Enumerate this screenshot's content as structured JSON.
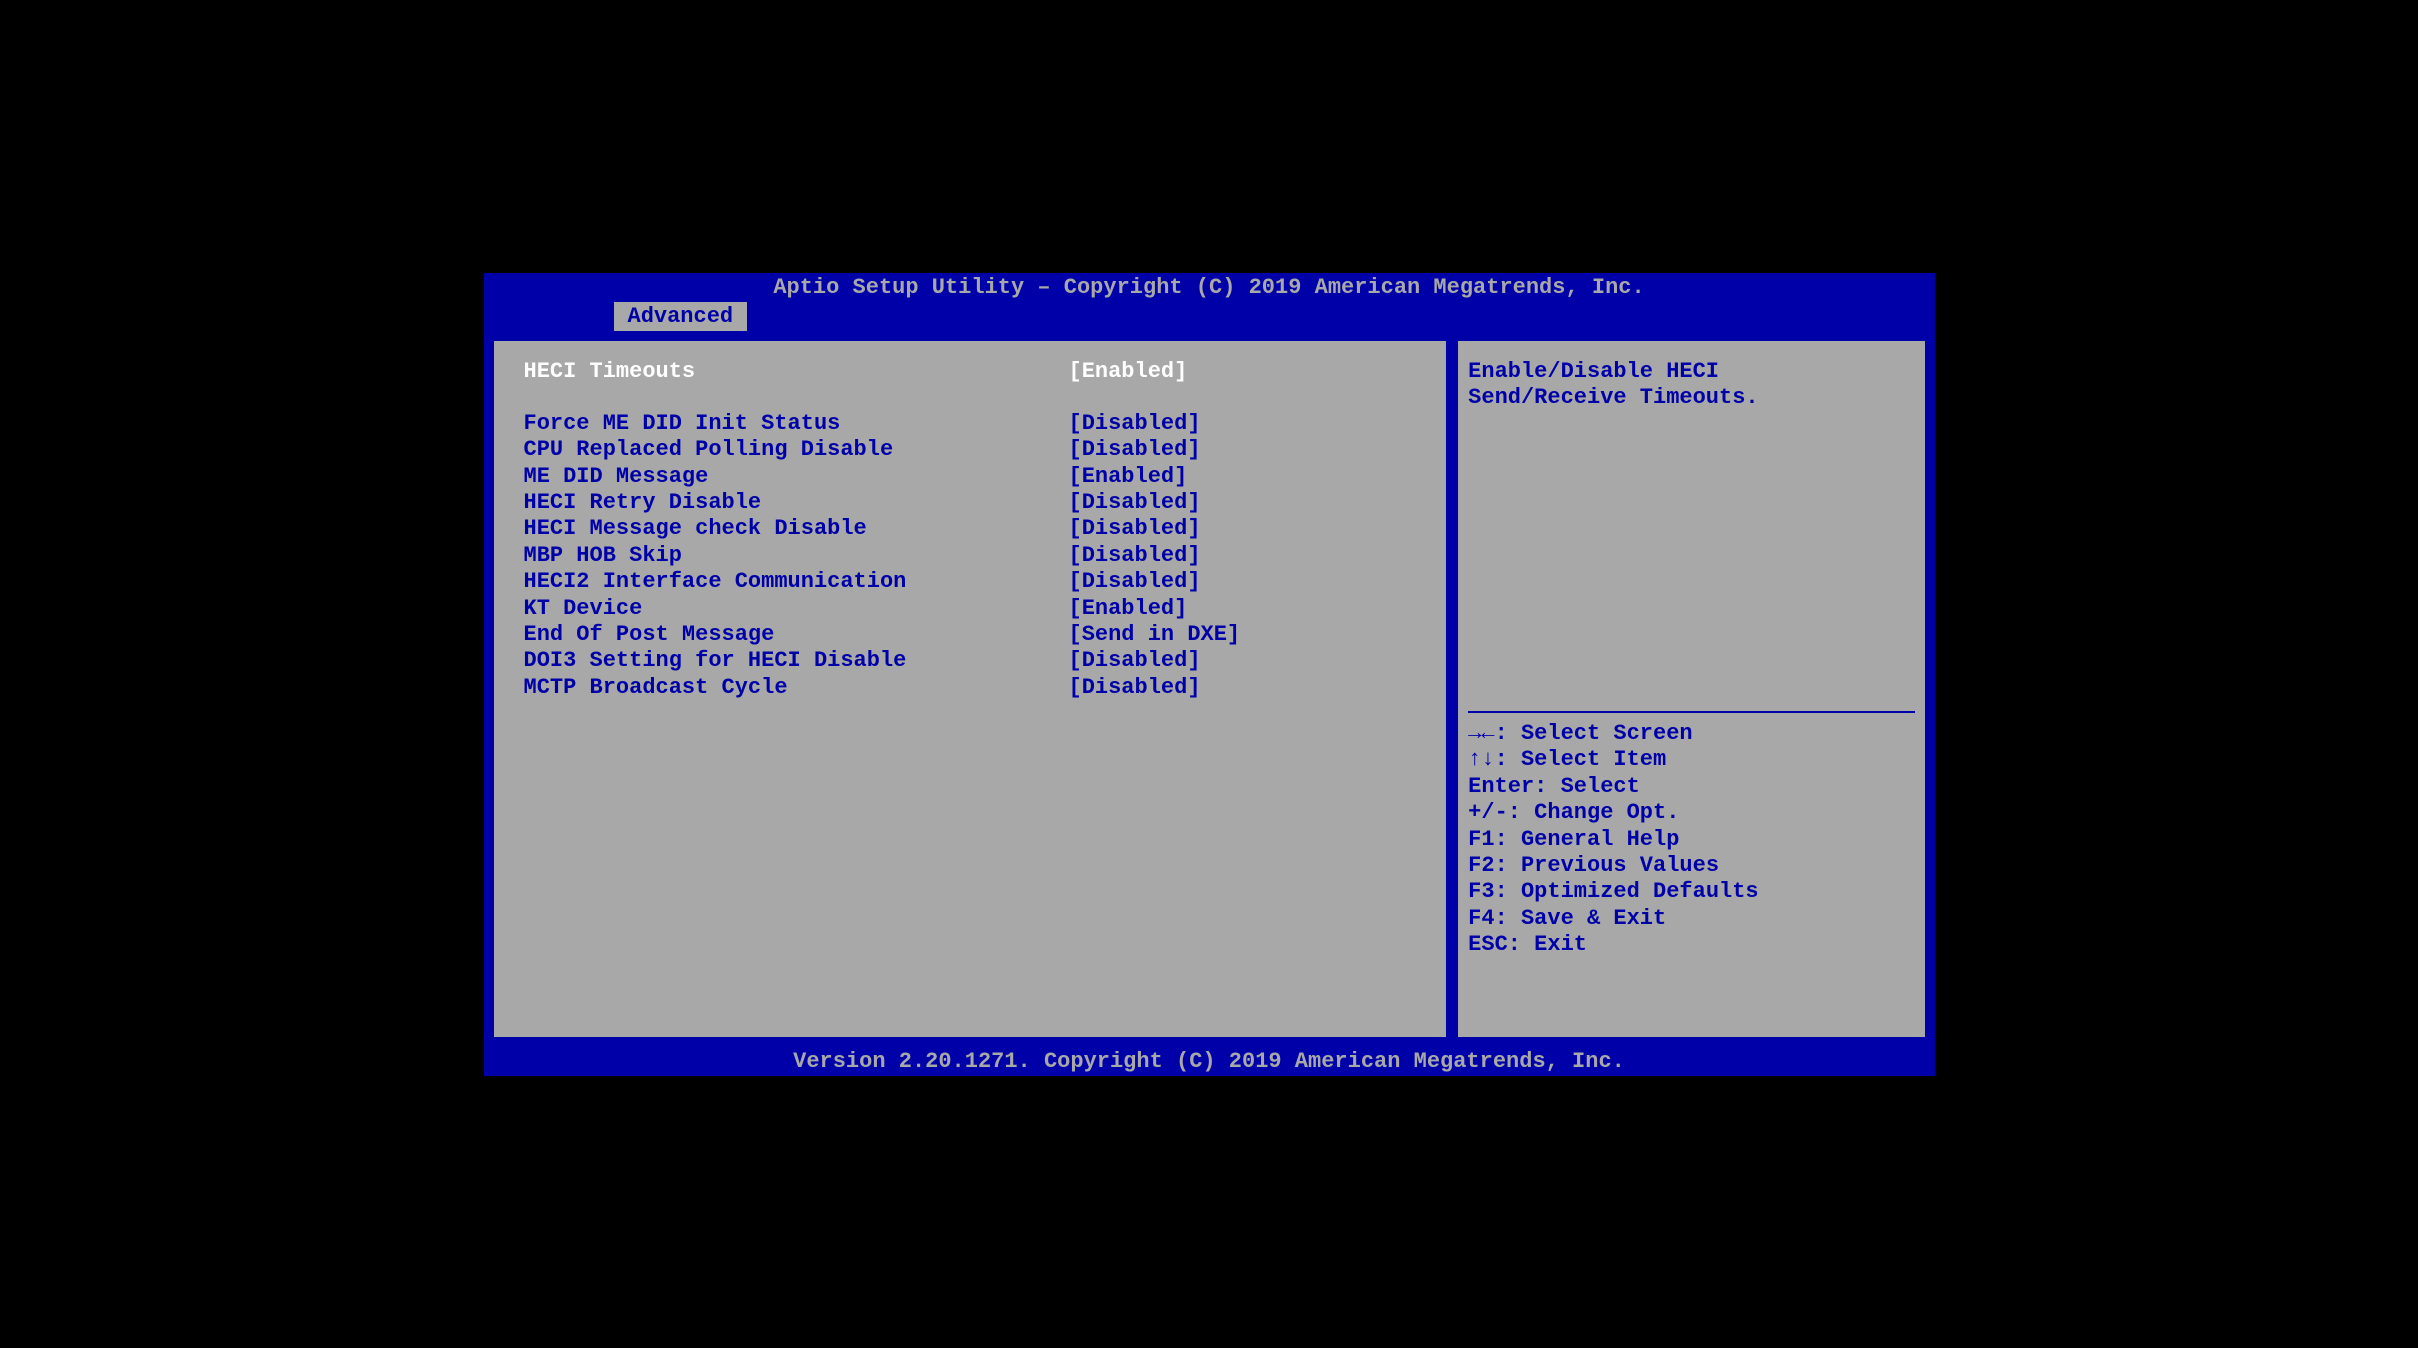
{
  "header": {
    "title": "Aptio Setup Utility – Copyright (C) 2019 American Megatrends, Inc."
  },
  "tabs": {
    "active": "Advanced"
  },
  "settings": [
    {
      "label": "HECI Timeouts",
      "value": "[Enabled]",
      "selected": true
    },
    {
      "blank": true
    },
    {
      "label": "Force ME DID Init Status",
      "value": "[Disabled]",
      "selected": false
    },
    {
      "label": "CPU Replaced Polling Disable",
      "value": "[Disabled]",
      "selected": false
    },
    {
      "label": "ME DID Message",
      "value": "[Enabled]",
      "selected": false
    },
    {
      "label": "HECI Retry Disable",
      "value": "[Disabled]",
      "selected": false
    },
    {
      "label": "HECI Message check Disable",
      "value": "[Disabled]",
      "selected": false
    },
    {
      "label": "MBP HOB Skip",
      "value": "[Disabled]",
      "selected": false
    },
    {
      "label": "HECI2 Interface Communication",
      "value": "[Disabled]",
      "selected": false
    },
    {
      "label": "KT Device",
      "value": "[Enabled]",
      "selected": false
    },
    {
      "label": "End Of Post Message",
      "value": "[Send in DXE]",
      "selected": false
    },
    {
      "label": "DOI3 Setting for HECI Disable",
      "value": "[Disabled]",
      "selected": false
    },
    {
      "label": "MCTP Broadcast Cycle",
      "value": "[Disabled]",
      "selected": false
    }
  ],
  "help": {
    "text": "Enable/Disable HECI\nSend/Receive Timeouts."
  },
  "legend": [
    {
      "keys": "→←:",
      "action": "Select Screen"
    },
    {
      "keys": "↑↓:",
      "action": "Select Item"
    },
    {
      "keys": "Enter:",
      "action": "Select"
    },
    {
      "keys": "+/-:",
      "action": "Change Opt."
    },
    {
      "keys": "F1:",
      "action": "General Help"
    },
    {
      "keys": "F2:",
      "action": "Previous Values"
    },
    {
      "keys": "F3:",
      "action": "Optimized Defaults"
    },
    {
      "keys": "F4:",
      "action": "Save & Exit"
    },
    {
      "keys": "ESC:",
      "action": "Exit"
    }
  ],
  "footer": {
    "text": "Version 2.20.1271. Copyright (C) 2019 American Megatrends, Inc."
  }
}
